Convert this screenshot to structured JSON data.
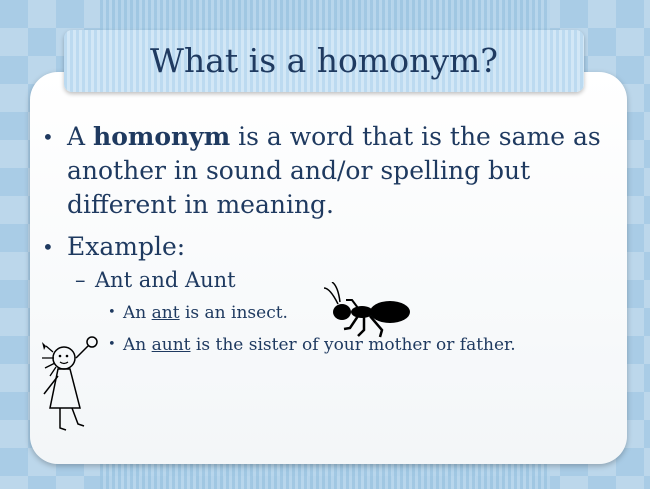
{
  "slide": {
    "title": "What is a homonym?",
    "bullets": {
      "definition": {
        "prefix": "A",
        "term": "homonym",
        "rest": "is a word that is the same as another in sound and/or spelling but different in meaning."
      },
      "example_label": "Example:",
      "pair": "Ant and Aunt",
      "ant_sentence": {
        "before": "An",
        "word": "ant",
        "after": "is an insect."
      },
      "aunt_sentence": {
        "before": "An",
        "word": "aunt",
        "after": "is the sister of your mother or father."
      }
    }
  },
  "colors": {
    "text": "#1f3a60",
    "background": "#a9cce6",
    "banner": "#c9e1f3"
  },
  "icons": [
    "ant-clipart",
    "girl-stick-figure-clipart"
  ]
}
